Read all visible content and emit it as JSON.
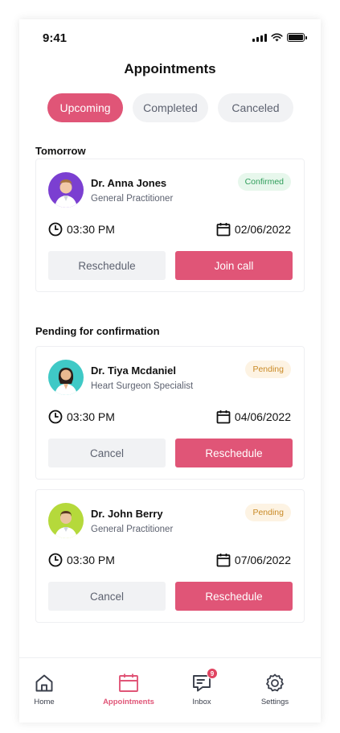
{
  "status_bar": {
    "time": "9:41"
  },
  "page_title": "Appointments",
  "tabs": [
    {
      "label": "Upcoming",
      "active": true
    },
    {
      "label": "Completed",
      "active": false
    },
    {
      "label": "Canceled",
      "active": false
    }
  ],
  "sections": [
    {
      "title": "Tomorrow",
      "cards": [
        {
          "doctor": "Dr. Anna Jones",
          "specialty": "General Practitioner",
          "status": "Confirmed",
          "time": "03:30 PM",
          "date": "02/06/2022",
          "secondary_action": "Reschedule",
          "primary_action": "Join call",
          "avatar_color": "#7b3fd1"
        }
      ]
    },
    {
      "title": "Pending for confirmation",
      "cards": [
        {
          "doctor": "Dr. Tiya Mcdaniel",
          "specialty": "Heart Surgeon Specialist",
          "status": "Pending",
          "time": "03:30 PM",
          "date": "04/06/2022",
          "secondary_action": "Cancel",
          "primary_action": "Reschedule",
          "avatar_color": "#3fc9c6"
        },
        {
          "doctor": "Dr. John Berry",
          "specialty": "General Practitioner",
          "status": "Pending",
          "time": "03:30 PM",
          "date": "07/06/2022",
          "secondary_action": "Cancel",
          "primary_action": "Reschedule",
          "avatar_color": "#b5d93b"
        }
      ]
    }
  ],
  "nav": {
    "home": {
      "label": "Home",
      "icon": "home-icon"
    },
    "appointments": {
      "label": "Appointments",
      "icon": "calendar-icon"
    },
    "inbox": {
      "label": "Inbox",
      "icon": "chat-icon",
      "badge": "9"
    },
    "settings": {
      "label": "Settings",
      "icon": "gear-icon"
    }
  },
  "colors": {
    "accent": "#e05577",
    "confirmed": "#2f9d5a",
    "pending": "#c98a26"
  }
}
